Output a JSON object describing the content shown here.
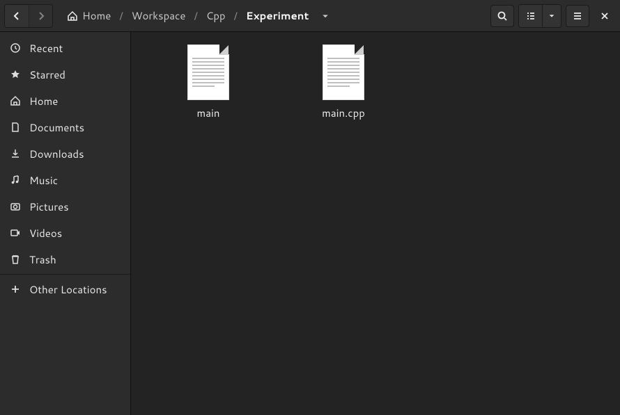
{
  "breadcrumb": {
    "items": [
      {
        "label": "Home"
      },
      {
        "label": "Workspace"
      },
      {
        "label": "Cpp"
      },
      {
        "label": "Experiment"
      }
    ]
  },
  "sidebar": {
    "items": [
      {
        "icon": "clock-icon",
        "label": "Recent"
      },
      {
        "icon": "star-icon",
        "label": "Starred"
      },
      {
        "icon": "home-icon",
        "label": "Home"
      },
      {
        "icon": "document-icon",
        "label": "Documents"
      },
      {
        "icon": "download-icon",
        "label": "Downloads"
      },
      {
        "icon": "music-icon",
        "label": "Music"
      },
      {
        "icon": "camera-icon",
        "label": "Pictures"
      },
      {
        "icon": "video-icon",
        "label": "Videos"
      },
      {
        "icon": "trash-icon",
        "label": "Trash"
      }
    ],
    "other": {
      "label": "Other Locations"
    }
  },
  "files": [
    {
      "name": "main"
    },
    {
      "name": "main.cpp"
    }
  ]
}
